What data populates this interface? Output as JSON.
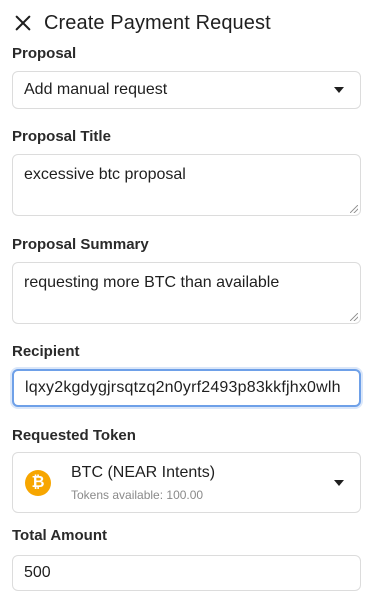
{
  "header": {
    "title": "Create Payment Request",
    "close_icon": "close-icon"
  },
  "proposal": {
    "label": "Proposal",
    "selected": "Add manual request"
  },
  "proposal_title": {
    "label": "Proposal Title",
    "value": "excessive btc proposal"
  },
  "proposal_summary": {
    "label": "Proposal Summary",
    "value": "requesting more BTC than available"
  },
  "recipient": {
    "label": "Recipient",
    "value": "lqxy2kgdygjrsqtzq2n0yrf2493p83kkfjhx0wlh"
  },
  "requested_token": {
    "label": "Requested Token",
    "icon_symbol": "₿",
    "icon_color": "#f7a600",
    "name": "BTC (NEAR Intents)",
    "available": "Tokens available: 100.00"
  },
  "total_amount": {
    "label": "Total Amount",
    "value": "500"
  }
}
